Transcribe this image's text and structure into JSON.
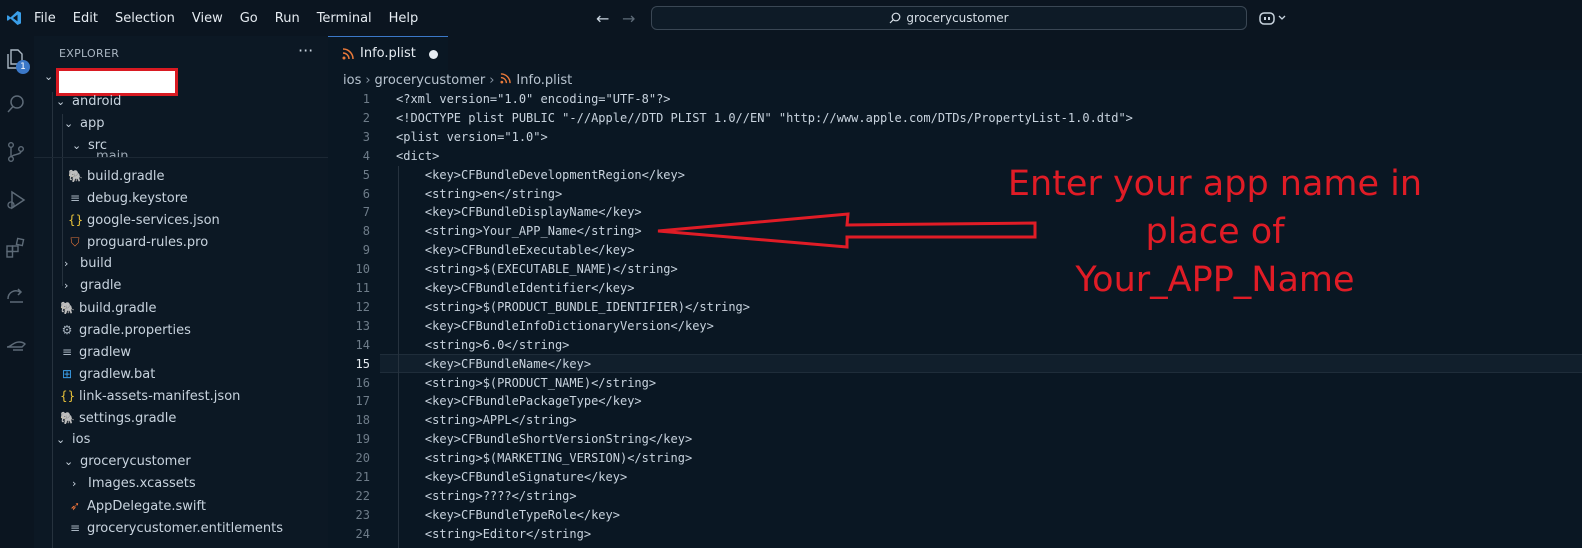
{
  "menu": [
    "File",
    "Edit",
    "Selection",
    "View",
    "Go",
    "Run",
    "Terminal",
    "Help"
  ],
  "search": {
    "text": "grocerycustomer"
  },
  "activity": {
    "badge": "1"
  },
  "sidebar": {
    "title": "EXPLORER",
    "more": "···",
    "tree": [
      {
        "label": "android",
        "type": "folder-open"
      },
      {
        "label": "app",
        "type": "folder-open"
      },
      {
        "label": "src",
        "type": "folder-open"
      },
      {
        "label": "main",
        "type": "folder-clipped"
      },
      {
        "label": "build.gradle",
        "type": "gradle"
      },
      {
        "label": "debug.keystore",
        "type": "file"
      },
      {
        "label": "google-services.json",
        "type": "json"
      },
      {
        "label": "proguard-rules.pro",
        "type": "pro"
      },
      {
        "label": "build",
        "type": "folder"
      },
      {
        "label": "gradle",
        "type": "folder"
      },
      {
        "label": "build.gradle",
        "type": "gradle"
      },
      {
        "label": "gradle.properties",
        "type": "gear"
      },
      {
        "label": "gradlew",
        "type": "file"
      },
      {
        "label": "gradlew.bat",
        "type": "windows"
      },
      {
        "label": "link-assets-manifest.json",
        "type": "json"
      },
      {
        "label": "settings.gradle",
        "type": "gradle"
      },
      {
        "label": "ios",
        "type": "folder-open"
      },
      {
        "label": "grocerycustomer",
        "type": "folder-open"
      },
      {
        "label": "Images.xcassets",
        "type": "folder"
      },
      {
        "label": "AppDelegate.swift",
        "type": "swift"
      },
      {
        "label": "grocerycustomer.entitlements",
        "type": "file"
      }
    ]
  },
  "editor": {
    "tab": {
      "label": "Info.plist"
    },
    "breadcrumb": [
      "ios",
      "grocerycustomer",
      "Info.plist"
    ],
    "active_line": 15,
    "lines": [
      "<?xml version=\"1.0\" encoding=\"UTF-8\"?>",
      "<!DOCTYPE plist PUBLIC \"-//Apple//DTD PLIST 1.0//EN\" \"http://www.apple.com/DTDs/PropertyList-1.0.dtd\">",
      "<plist version=\"1.0\">",
      "<dict>",
      "    <key>CFBundleDevelopmentRegion</key>",
      "    <string>en</string>",
      "    <key>CFBundleDisplayName</key>",
      "    <string>Your_APP_Name</string>",
      "    <key>CFBundleExecutable</key>",
      "    <string>$(EXECUTABLE_NAME)</string>",
      "    <key>CFBundleIdentifier</key>",
      "    <string>$(PRODUCT_BUNDLE_IDENTIFIER)</string>",
      "    <key>CFBundleInfoDictionaryVersion</key>",
      "    <string>6.0</string>",
      "    <key>CFBundleName</key>",
      "    <string>$(PRODUCT_NAME)</string>",
      "    <key>CFBundlePackageType</key>",
      "    <string>APPL</string>",
      "    <key>CFBundleShortVersionString</key>",
      "    <string>$(MARKETING_VERSION)</string>",
      "    <key>CFBundleSignature</key>",
      "    <string>????</string>",
      "    <key>CFBundleTypeRole</key>",
      "    <string>Editor</string>"
    ]
  },
  "callout": {
    "lines": [
      "Enter your app name in",
      "place of",
      "Your_APP_Name"
    ],
    "color": "#e01c26"
  }
}
